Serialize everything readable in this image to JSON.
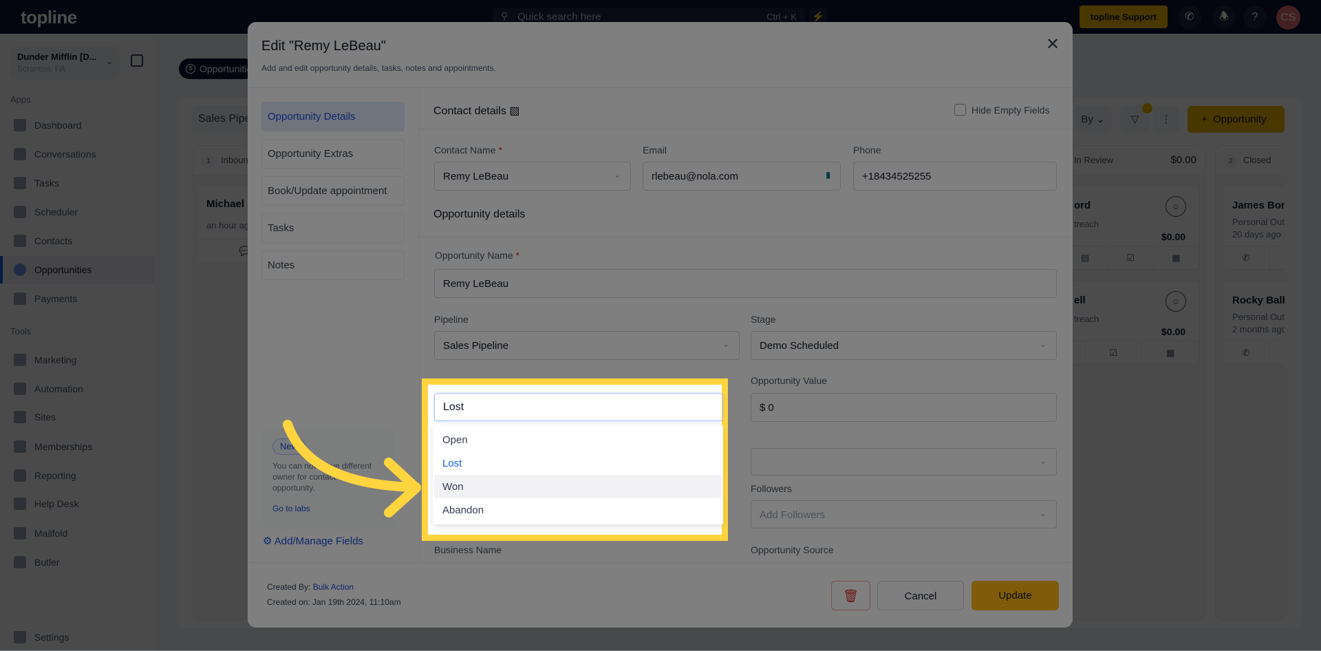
{
  "topbar": {
    "logo": "topline",
    "search_placeholder": "Quick search here",
    "search_shortcut": "Ctrl + K",
    "support_label": "topline Support",
    "avatar_initials": "CS"
  },
  "sidebar": {
    "org_name": "Dunder Mifflin [D...",
    "org_location": "Scranton, PA",
    "apps_label": "Apps",
    "tools_label": "Tools",
    "apps": [
      {
        "label": "Dashboard"
      },
      {
        "label": "Conversations"
      },
      {
        "label": "Tasks"
      },
      {
        "label": "Scheduler"
      },
      {
        "label": "Contacts"
      },
      {
        "label": "Opportunities",
        "active": true
      },
      {
        "label": "Payments"
      }
    ],
    "tools": [
      {
        "label": "Marketing"
      },
      {
        "label": "Automation"
      },
      {
        "label": "Sites"
      },
      {
        "label": "Memberships"
      },
      {
        "label": "Reporting"
      },
      {
        "label": "Help Desk"
      },
      {
        "label": "Mailfold"
      },
      {
        "label": "Butler"
      }
    ],
    "settings_label": "Settings"
  },
  "main": {
    "tab_label": "Opportunities",
    "pipeline_select": "Sales Pipeline",
    "sort_label": "By",
    "add_button": "Opportunity",
    "columns": [
      {
        "badge": "1",
        "name": "Inbound",
        "cards": [
          {
            "name": "Michael S",
            "time": "an hour ago"
          }
        ]
      },
      {
        "name": "In Review",
        "amount": "$0.00",
        "cards": [
          {
            "name": "ord",
            "source": "treach",
            "value": "$0.00"
          },
          {
            "name": "ell",
            "source": "treach",
            "value": "$0.00"
          }
        ]
      },
      {
        "badge": "2",
        "name": "Closed",
        "cards": [
          {
            "name": "James Bond",
            "source": "Personal Outreach",
            "time": "20 days ago"
          },
          {
            "name": "Rocky Balboa",
            "source": "Personal Outreach",
            "time": "2 months ago"
          }
        ]
      }
    ]
  },
  "modal": {
    "title": "Edit \"Remy LeBeau\"",
    "subtitle": "Add and edit opportunity details, tasks, notes and appointments.",
    "nav": [
      {
        "label": "Opportunity Details",
        "active": true
      },
      {
        "label": "Opportunity Extras"
      },
      {
        "label": "Book/Update appointment"
      },
      {
        "label": "Tasks"
      },
      {
        "label": "Notes"
      }
    ],
    "labs": {
      "badge": "New",
      "text": "You can now have different owner for contact and opportunity.",
      "link": "Go to labs"
    },
    "add_fields": "Add/Manage Fields",
    "contact_section": "Contact details",
    "hide_empty": "Hide Empty Fields",
    "contact_name_label": "Contact Name",
    "contact_name": "Remy LeBeau",
    "email_label": "Email",
    "email": "rlebeau@nola.com",
    "phone_label": "Phone",
    "phone": "+18434525255",
    "opp_section": "Opportunity details",
    "opp_name_label": "Opportunity Name",
    "opp_name": "Remy LeBeau",
    "pipeline_label": "Pipeline",
    "pipeline": "Sales Pipeline",
    "stage_label": "Stage",
    "stage": "Demo Scheduled",
    "value_label": "Opportunity Value",
    "value": "$ 0",
    "followers_label": "Followers",
    "followers_placeholder": "Add Followers",
    "business_label": "Business Name",
    "source_label": "Opportunity Source",
    "created_by_label": "Created By:",
    "created_by": "Bulk Action",
    "created_on": "Created on: Jan 19th 2024, 11:10am",
    "cancel": "Cancel",
    "update": "Update",
    "status": {
      "value": "Lost",
      "options": [
        {
          "label": "Open"
        },
        {
          "label": "Lost",
          "selected": true
        },
        {
          "label": "Won",
          "hovered": true
        },
        {
          "label": "Abandon"
        }
      ]
    }
  },
  "colors": {
    "accent": "#feb814",
    "highlight": "#ffd43f",
    "link": "#1d4ed8"
  }
}
